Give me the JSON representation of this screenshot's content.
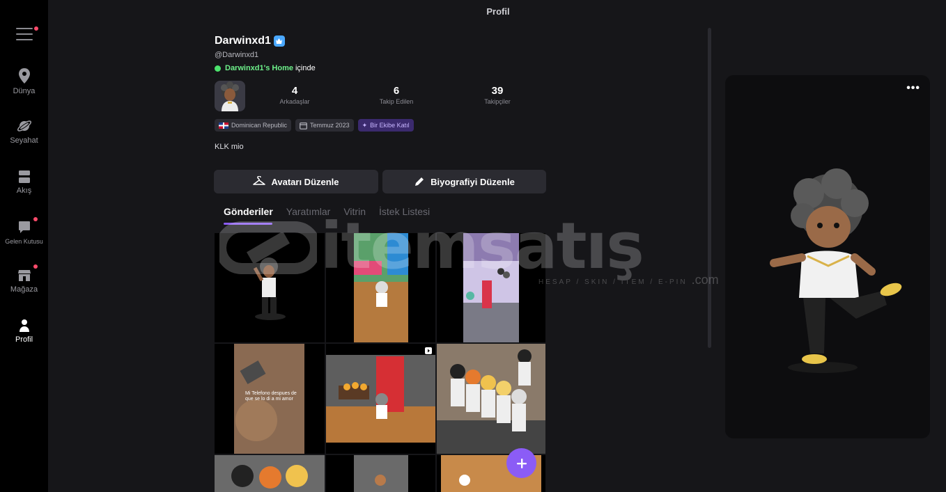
{
  "window": {
    "title": "Profil"
  },
  "sidebar": {
    "items": [
      {
        "label": "Dünya",
        "icon": "map-pin-icon",
        "badge": false,
        "active": false
      },
      {
        "label": "Seyahat",
        "icon": "planet-icon",
        "badge": false,
        "active": false
      },
      {
        "label": "Akış",
        "icon": "feed-icon",
        "badge": false,
        "active": false
      },
      {
        "label": "Gelen Kutusu",
        "icon": "chat-icon",
        "badge": true,
        "active": false
      },
      {
        "label": "Mağaza",
        "icon": "shop-icon",
        "badge": true,
        "active": false
      },
      {
        "label": "Profil",
        "icon": "person-icon",
        "badge": false,
        "active": true
      }
    ],
    "menu_badge": true
  },
  "profile": {
    "display_name": "Darwinxd1",
    "handle": "@Darwinxd1",
    "presence_place": "Darwinxd1's Home",
    "presence_suffix": "içinde",
    "stats": [
      {
        "value": "4",
        "label": "Arkadaşlar"
      },
      {
        "value": "6",
        "label": "Takip Edilen"
      },
      {
        "value": "39",
        "label": "Takipçiler"
      }
    ],
    "chips": {
      "country": "Dominican Republic",
      "joined": "Temmuz 2023",
      "team": "Bir Ekibe Katıl"
    },
    "bio": "KLK mio"
  },
  "actions": {
    "edit_avatar": "Avatarı Düzenle",
    "edit_bio": "Biyografiyi Düzenle"
  },
  "tabs": [
    {
      "label": "Gönderiler",
      "active": true
    },
    {
      "label": "Yaratımlar",
      "active": false
    },
    {
      "label": "Vitrin",
      "active": false
    },
    {
      "label": "İstek Listesi",
      "active": false
    }
  ],
  "posts": {
    "caption_text": "Mi Telefono despues de que se lo di a mi amor"
  },
  "watermark": {
    "brand": "itemsatış",
    "tagline": "HESAP / SKIN / ITEM / E-PIN",
    "domain": ".com"
  },
  "colors": {
    "accent": "#8b5cf6",
    "online": "#4ce36d",
    "badge": "#ff4b6b"
  }
}
